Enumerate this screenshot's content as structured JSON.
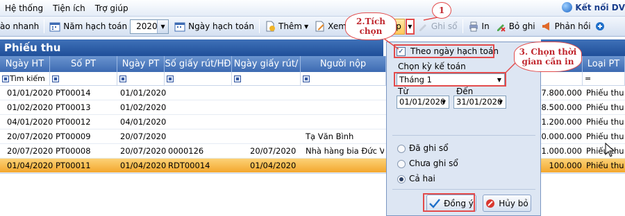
{
  "menubar": {
    "items": [
      "Hệ thống",
      "Tiện ích",
      "Trợ giúp"
    ],
    "brand": "Kết nối DV"
  },
  "toolbar": {
    "quick_search": "ào nhanh",
    "fiscal_year_label": "Năm hạch toán",
    "fiscal_year_value": "2020",
    "posting_date_label": "Ngày hạch toán",
    "add_label": "Thêm",
    "view_label": "Xem",
    "load_label": "Nạp",
    "post_label": "Ghi sổ",
    "print_label": "In",
    "unpost_label": "Bỏ ghi",
    "feedback_label": "Phản hồi"
  },
  "panel": {
    "title": "Phiếu thu"
  },
  "grid": {
    "columns": [
      "Ngày HT",
      "Số PT",
      "Ngày PT",
      "Số giấy rút/HĐ",
      "Ngày giấy rút/",
      "Người nộp",
      "",
      "Loại PT"
    ],
    "filter_label": "Tìm kiếm",
    "filter_op": "=",
    "rows": [
      {
        "ngay_ht": "01/01/2020",
        "so_pt": "PT00014",
        "ngay_pt": "01/01/2020",
        "so_giay": "",
        "ngay_giay": "",
        "nguoi_nop": "",
        "amount": "7.800.000",
        "loai": "Phiếu thu"
      },
      {
        "ngay_ht": "01/02/2020",
        "so_pt": "PT00013",
        "ngay_pt": "01/02/2020",
        "so_giay": "",
        "ngay_giay": "",
        "nguoi_nop": "",
        "amount": "8.500.000",
        "loai": "Phiếu thu"
      },
      {
        "ngay_ht": "04/01/2020",
        "so_pt": "PT00012",
        "ngay_pt": "04/01/2020",
        "so_giay": "",
        "ngay_giay": "",
        "nguoi_nop": "",
        "amount": "1.200.000",
        "loai": "Phiếu thu"
      },
      {
        "ngay_ht": "20/07/2020",
        "so_pt": "PT00009",
        "ngay_pt": "20/07/2020",
        "so_giay": "",
        "ngay_giay": "",
        "nguoi_nop": "Tạ Văn Bình",
        "amount": "10.000.000",
        "loai": "Phiếu thu"
      },
      {
        "ngay_ht": "20/07/2020",
        "so_pt": "PT00008",
        "ngay_pt": "20/07/2020",
        "so_giay": "0000126",
        "ngay_giay": "20/07/2020",
        "nguoi_nop": "Nhà hàng bia Đức Việ",
        "amount": "1.000.000",
        "loai": "Phiếu thu"
      },
      {
        "ngay_ht": "01/04/2020",
        "so_pt": "PT00011",
        "ngay_pt": "01/04/2020",
        "so_giay": "RDT00014",
        "ngay_giay": "01/04/2020",
        "nguoi_nop": "",
        "amount": "100.000",
        "loai": "Phiếu thu"
      }
    ],
    "selected_row": 5
  },
  "popup": {
    "by_posting_date_label": "Theo ngày hạch toán",
    "by_posting_date_checked": true,
    "period_label": "Chọn kỳ kế toán",
    "period_value": "Tháng 1",
    "from_label": "Từ",
    "from_value": "01/01/2020",
    "to_label": "Đến",
    "to_value": "31/01/2020",
    "status_options": [
      "Đã ghi sổ",
      "Chưa ghi sổ",
      "Cả hai"
    ],
    "status_selected": "Cả hai",
    "ok_label": "Đồng ý",
    "cancel_label": "Hủy bỏ"
  },
  "annotations": {
    "step1": "1",
    "step2": "2.Tích chọn",
    "step3": "3. Chọn thời gian cần in"
  },
  "colors": {
    "header_blue": "#2d5da6",
    "selected_row": "#f3a72e",
    "annotation_red": "#e34b4b"
  }
}
